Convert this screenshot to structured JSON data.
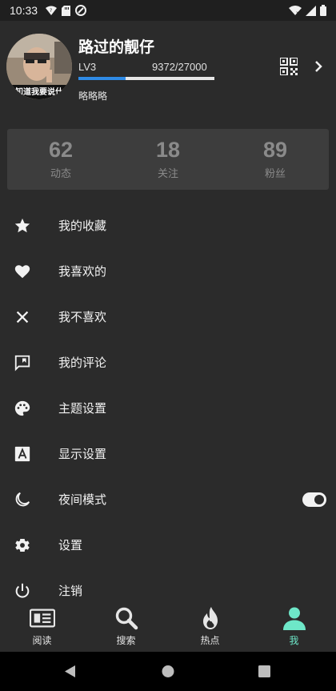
{
  "status_bar": {
    "time": "10:33",
    "icons_left": [
      "wifi-question-icon",
      "sd-card-icon",
      "vpn-icon"
    ],
    "icons_right": [
      "wifi-signal-icon",
      "cell-signal-icon",
      "battery-icon"
    ]
  },
  "profile": {
    "username": "路过的靓仔",
    "level": "LV3",
    "exp_text": "9372/27000",
    "exp_progress": 0.347,
    "signature": "略略略",
    "avatar_caption": "知道我要说什"
  },
  "stats": [
    {
      "value": "62",
      "label": "动态"
    },
    {
      "value": "18",
      "label": "关注"
    },
    {
      "value": "89",
      "label": "粉丝"
    }
  ],
  "menu": [
    {
      "label": "我的收藏",
      "icon": "star-icon"
    },
    {
      "label": "我喜欢的",
      "icon": "heart-icon"
    },
    {
      "label": "我不喜欢",
      "icon": "close-icon"
    },
    {
      "label": "我的评论",
      "icon": "comment-icon"
    },
    {
      "label": "主题设置",
      "icon": "palette-icon"
    },
    {
      "label": "显示设置",
      "icon": "font-icon"
    },
    {
      "label": "夜间模式",
      "icon": "moon-icon",
      "toggle": true
    },
    {
      "label": "设置",
      "icon": "gear-icon"
    },
    {
      "label": "注销",
      "icon": "power-icon"
    }
  ],
  "bottom_nav": [
    {
      "label": "阅读",
      "icon": "newspaper-icon"
    },
    {
      "label": "搜索",
      "icon": "search-icon"
    },
    {
      "label": "热点",
      "icon": "flame-icon"
    },
    {
      "label": "我",
      "icon": "person-icon",
      "active": true
    }
  ],
  "colors": {
    "accent": "#6ee7c8",
    "progress": "#2f8be6",
    "background": "#2b2b2b",
    "card": "#3d3d3d"
  }
}
